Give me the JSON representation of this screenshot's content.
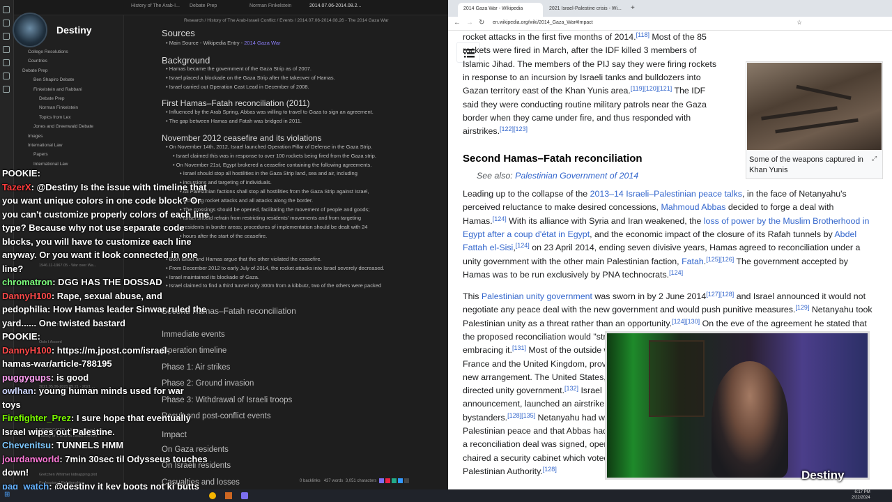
{
  "obsidian": {
    "tabs": [
      "History of The Arab-I...",
      "Debate Prep",
      "Norman Finkelstein",
      "2014.07.06-2014.08.2..."
    ],
    "breadcrumb": "Research / History of The Arab-Israeli Conflict / Events / 2014.07.06-2014.08.26 - The 2014 Gaza War",
    "sidebar": [
      "College Resolutions",
      "Countries",
      "Debate Prep",
      "Ben Shapiro Debate",
      "Finkelstein and Rabbani",
      "Debate Prep",
      "Norman Finkelstein",
      "Topics from Lex",
      "Jones and Greenwald Debate",
      "Images",
      "International Law",
      "Papers",
      "International Law"
    ],
    "sidebar_ghost": [
      "1946.11-1967.05 - War over Wa...",
      "1967.06 - The Six-Day War, fo...",
      "Oslo I Accord",
      "2021.05.06-2021.05.21 - 2021 ...",
      "DEPRECATED - History of Israel and...",
      "History of The Arab-Israeli Conflict",
      "Articles",
      "Gretchen Whitmer kidnapping plot",
      "Professional Relationships"
    ],
    "note": {
      "sources_title": "Sources",
      "sources_item_prefix": "Main Source - Wikipedia Entry - ",
      "sources_item_link": "2014 Gaza War",
      "background_title": "Background",
      "background": [
        "Hamas became the government of the Gaza Strip as of 2007.",
        "Israel placed a blockade on the Gaza Strip after the takeover of Hamas.",
        "Israel carried out Operation Cast Lead in December of 2008."
      ],
      "first_recon_title": "First Hamas–Fatah reconciliation (2011)",
      "first_recon": [
        "Influenced by the Arab Spring, Abbas was willing to travel to Gaza to sign an agreement.",
        "The gap between Hamas and Fatah was bridged in 2011."
      ],
      "nov_title": "November 2012 ceasefire and its violations",
      "nov": [
        "On November 14th, 2012, Israel launched Operation Pillar of Defense in the Gaza Strip.",
        "Israel claimed this was in response to over 100 rockets being fired from the Gaza strip.",
        "On November 21st, Egypt brokered a ceasefire containing the following agreements.",
        "Israel should stop all hostilities in the Gaza Strip land, sea and air, including",
        "incursions and targeting of individuals.",
        "All Palestinian factions shall stop all hostilities from the Gaza Strip against Israel,",
        "including rocket attacks and all attacks along the border.",
        "The crossings should be opened, facilitating the movement of people and goods;",
        "Israel should refrain from restricting residents' movements and from targeting",
        "residents in border areas; procedures of implementation should be dealt with 24",
        "hours after the start of the ceasefire."
      ],
      "violations": [
        "Both Israel and Hamas argue that the other violated the ceasefire.",
        "From December 2012 to early July of 2014, the rocket attacks into Israel severely decreased.",
        "Israel maintained its blockade of Gaza.",
        "Israel claimed to find a third tunnel only 300m from a kibbutz, two of the others were packed"
      ],
      "second_recon_title": "Second Hamas–Fatah reconciliation",
      "outline": [
        "Immediate events",
        "Operation timeline",
        "Phase 1: Air strikes",
        "Phase 2: Ground invasion",
        "Phase 3: Withdrawal of Israeli troops",
        "Result and post-conflict events"
      ],
      "impact_title": "Impact",
      "impact": [
        "On Gaza residents",
        "On Israeli residents",
        "Casualties and losses"
      ]
    },
    "status": {
      "backlinks": "0 backlinks",
      "words": "437 words",
      "chars": "3,051 characters"
    }
  },
  "stream": {
    "name": "Destiny",
    "chat": [
      {
        "user": "POOKIE",
        "color": "#ffffff",
        "text": ":"
      },
      {
        "user": "TazerX",
        "color": "#ff3b3b",
        "text": ": @Destiny Is the issue with timeline that"
      },
      {
        "user": "",
        "color": "#ffffff",
        "text": "you want unique colors in one code block? Or"
      },
      {
        "user": "",
        "color": "#ffffff",
        "text": "you can't customize properly colors of each line"
      },
      {
        "user": "",
        "color": "#ffffff",
        "text": "type? Because why not use separate code"
      },
      {
        "user": "",
        "color": "#ffffff",
        "text": "blocks, you will have to customize each line"
      },
      {
        "user": "",
        "color": "#ffffff",
        "text": "anyway. Or you want it look connected in one"
      },
      {
        "user": "",
        "color": "#ffffff",
        "text": "line?"
      },
      {
        "user": "chromatron",
        "color": "#7cfc7c",
        "text": ": DGG HAS THE DOSSAD"
      },
      {
        "user": "DannyH100",
        "color": "#ff4a4a",
        "text": ": Rape, sexual abuse, and"
      },
      {
        "user": "",
        "color": "#ffffff",
        "text": "pedophilia: How Hamas leader Sinwar ruled the"
      },
      {
        "user": "",
        "color": "#ffffff",
        "text": "yard...... One twisted bastard"
      },
      {
        "user": "POOKIE",
        "color": "#ffffff",
        "text": ":"
      },
      {
        "user": "DannyH100",
        "color": "#ff4a4a",
        "text": ": https://m.jpost.com/israel-"
      },
      {
        "user": "",
        "color": "#ffffff",
        "text": "hamas-war/article-788195"
      },
      {
        "user": "puggygups",
        "color": "#ff9ff3",
        "text": ": is good"
      },
      {
        "user": "owlhan",
        "color": "#cfd8ff",
        "text": ": young human minds used for war"
      },
      {
        "user": "",
        "color": "#ffffff",
        "text": "toys"
      },
      {
        "user": "Firefighter_Prez",
        "color": "#7cfc00",
        "text": ": I sure hope that eventually"
      },
      {
        "user": "",
        "color": "#ffffff",
        "text": "Israel wipes out Palestine."
      },
      {
        "user": "Chevenitsu",
        "color": "#7ec8ff",
        "text": ": TUNNELS HMM"
      },
      {
        "user": "jourdanworld",
        "color": "#ff7ad9",
        "text": ": 7min 30sec til Odysseus touches"
      },
      {
        "user": "",
        "color": "#ffffff",
        "text": "down!"
      },
      {
        "user": "paq_watch",
        "color": "#66b3ff",
        "text": ": @destiny it key boots not ki butts"
      }
    ]
  },
  "browser": {
    "tabs": [
      "2014 Gaza War - Wikipedia",
      "2021 Israel-Palestine crisis - Wi..."
    ],
    "url": "en.wikipedia.org/wiki/2014_Gaza_War#Impact",
    "caption": "Some of the weapons captured in Khan Yunis",
    "heading": "Second Hamas–Fatah reconciliation",
    "see_also_prefix": "See also: ",
    "see_also_link": "Palestinian Government of 2014"
  },
  "taskbar": {
    "time": "6:17 PM",
    "date": "2/22/2024"
  },
  "colors": {
    "link": "#3366cc",
    "obsidian_bg": "#1e1e1e",
    "accent": "#7c6ff0"
  }
}
